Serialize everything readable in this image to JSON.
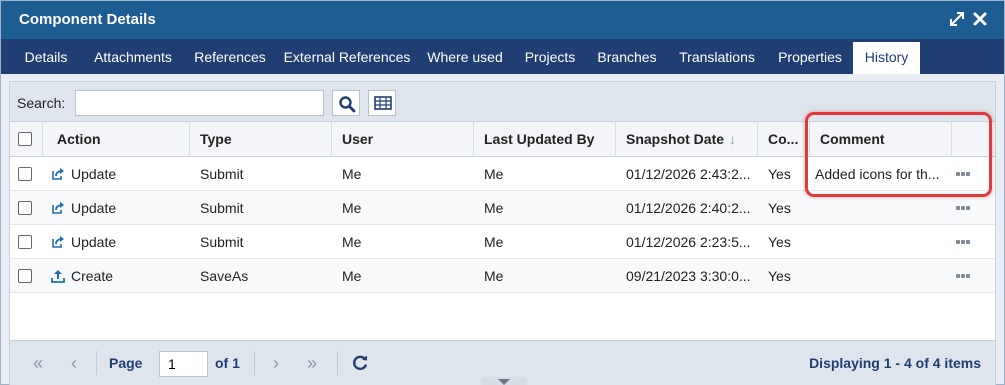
{
  "window": {
    "title": "Component Details",
    "icons": [
      "expand-icon",
      "close-icon"
    ]
  },
  "tabs": [
    {
      "label": "Details",
      "active": false
    },
    {
      "label": "Attachments",
      "active": false
    },
    {
      "label": "References",
      "active": false
    },
    {
      "label": "External References",
      "active": false
    },
    {
      "label": "Where used",
      "active": false
    },
    {
      "label": "Projects",
      "active": false
    },
    {
      "label": "Branches",
      "active": false
    },
    {
      "label": "Translations",
      "active": false
    },
    {
      "label": "Properties",
      "active": false
    },
    {
      "label": "History",
      "active": true
    }
  ],
  "toolbar": {
    "search_label": "Search:",
    "search_value": "",
    "icons": [
      "search-icon",
      "table-columns-icon"
    ]
  },
  "grid": {
    "columns": [
      "Action",
      "Type",
      "User",
      "Last Updated By",
      "Snapshot Date",
      "Co...",
      "Comment"
    ],
    "sort_indicator": "↓",
    "rows": [
      {
        "action": "Update",
        "action_icon": "update-icon",
        "type": "Submit",
        "user": "Me",
        "last_updated_by": "Me",
        "snapshot_date": "01/12/2026 2:43:2...",
        "co": "Yes",
        "comment": "Added icons for th..."
      },
      {
        "action": "Update",
        "action_icon": "update-icon",
        "type": "Submit",
        "user": "Me",
        "last_updated_by": "Me",
        "snapshot_date": "01/12/2026 2:40:2...",
        "co": "Yes",
        "comment": ""
      },
      {
        "action": "Update",
        "action_icon": "update-icon",
        "type": "Submit",
        "user": "Me",
        "last_updated_by": "Me",
        "snapshot_date": "01/12/2026 2:23:5...",
        "co": "Yes",
        "comment": ""
      },
      {
        "action": "Create",
        "action_icon": "create-icon",
        "type": "SaveAs",
        "user": "Me",
        "last_updated_by": "Me",
        "snapshot_date": "09/21/2023 3:30:0...",
        "co": "Yes",
        "comment": ""
      }
    ]
  },
  "pager": {
    "page_label": "Page",
    "page_value": "1",
    "of_label": "of 1",
    "status": "Displaying 1 - 4 of 4 items"
  },
  "colors": {
    "titlebar": "#1e5d91",
    "tabbar": "#1f3f73",
    "highlight": "#e03b3b",
    "accent": "#1f6fb2"
  }
}
